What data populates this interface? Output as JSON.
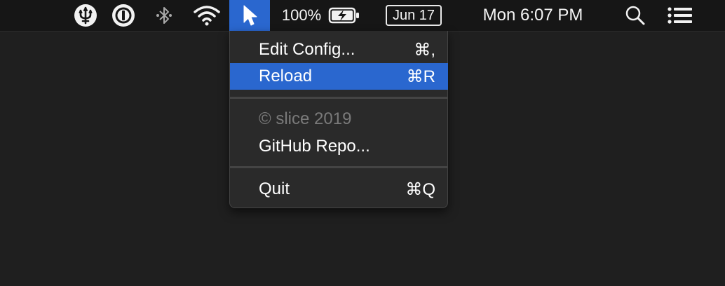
{
  "menubar": {
    "battery_percent": "100%",
    "date": "Jun 17",
    "clock": "Mon 6:07 PM",
    "icons": [
      "trident-icon",
      "onepassword-icon",
      "bluetooth-icon",
      "wifi-icon",
      "cursor-icon",
      "battery-charging-icon",
      "spotlight-search-icon",
      "notification-center-icon"
    ]
  },
  "menu": {
    "items": [
      {
        "label": "Edit Config...",
        "shortcut": "⌘,"
      },
      {
        "label": "Reload",
        "shortcut": "⌘R"
      },
      {
        "label": "© slice 2019",
        "shortcut": ""
      },
      {
        "label": "GitHub Repo...",
        "shortcut": ""
      },
      {
        "label": "Quit",
        "shortcut": "⌘Q"
      }
    ]
  },
  "colors": {
    "menubar_bg": "#161616",
    "desktop_bg": "#1f1f1f",
    "menu_bg": "#2a2a2a",
    "highlight": "#2a67cf",
    "disabled_text": "#7a7a7a"
  }
}
